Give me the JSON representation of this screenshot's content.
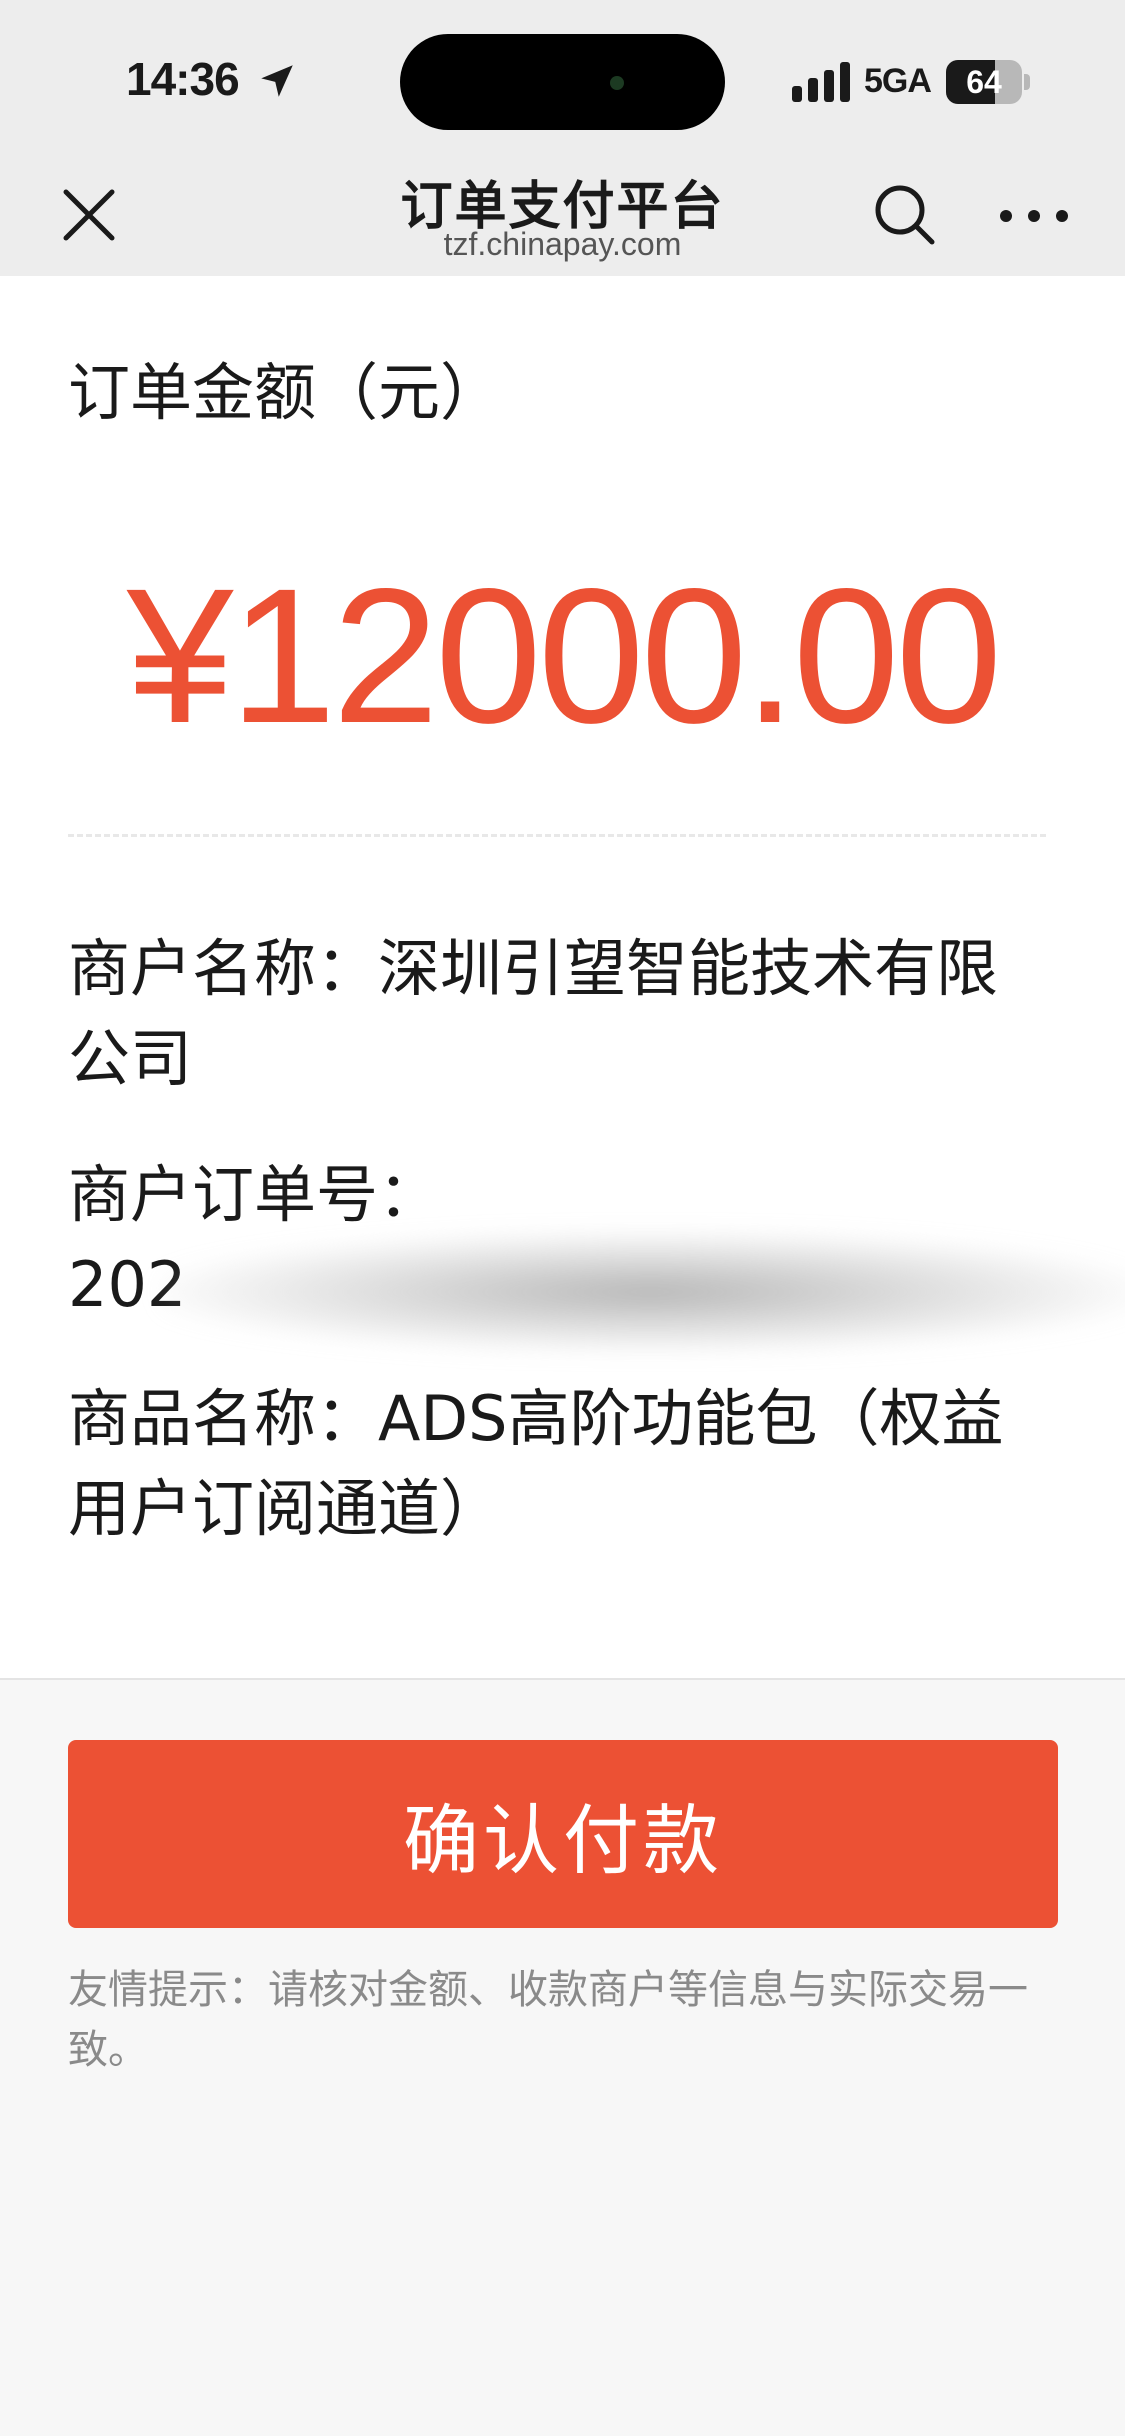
{
  "status_bar": {
    "time": "14:36",
    "network": "5GA",
    "battery_level": 64,
    "battery_text": "64",
    "icons": [
      "location-arrow-icon",
      "signal-bars-icon",
      "battery-icon"
    ]
  },
  "nav": {
    "title": "订单支付平台",
    "url": "tzf.chinapay.com",
    "icons": [
      "close-icon",
      "search-icon",
      "more-icon"
    ]
  },
  "order": {
    "amount_label": "订单金额（元）",
    "amount": "¥12000.00",
    "merchant_line": "商户名称：深圳引望智能技术有限公司",
    "order_no_label": "商户订单号：",
    "order_no_visible": "202",
    "product_line": "商品名称：ADS高阶功能包（权益用户订阅通道）"
  },
  "actions": {
    "confirm_label": "确认付款"
  },
  "tip": "友情提示：请核对金额、收款商户等信息与实际交易一致。",
  "colors": {
    "accent": "#ec5134",
    "nav_bg": "#ededed",
    "page_bg": "#f7f7f7",
    "card_bg": "#ffffff",
    "tip_text": "#8a8a8a"
  }
}
